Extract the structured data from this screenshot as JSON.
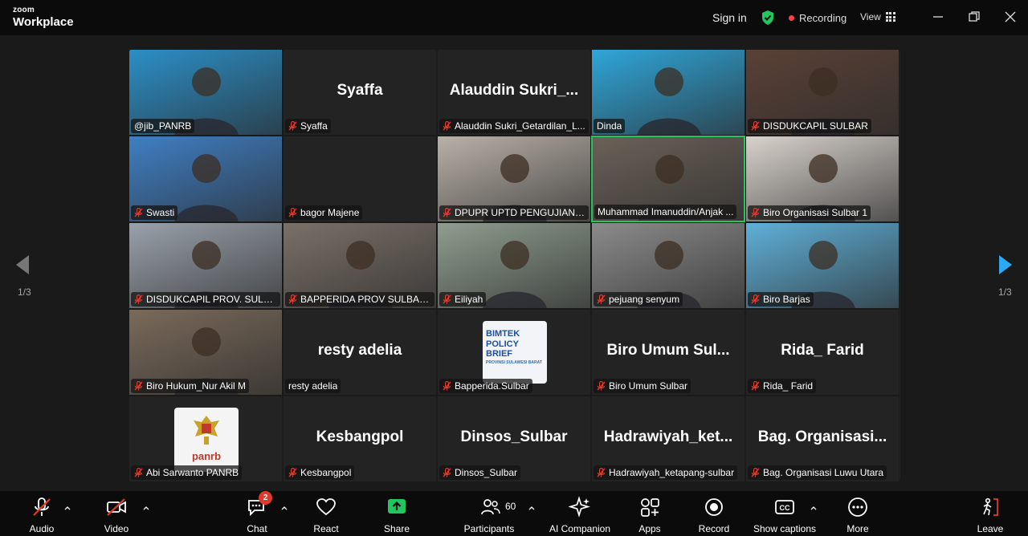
{
  "app": {
    "brand_top": "zoom",
    "brand_bottom": "Workplace"
  },
  "header": {
    "sign_in": "Sign in",
    "recording": "Recording",
    "view": "View"
  },
  "pager": {
    "left": "1/3",
    "right": "1/3"
  },
  "tiles": [
    {
      "name": "",
      "label": "@jib_PANRB",
      "muted": false,
      "type": "photo",
      "bg": "#2b8fc7"
    },
    {
      "name": "Syaffa",
      "label": "Syaffa",
      "muted": true,
      "type": "name"
    },
    {
      "name": "Alauddin  Sukri_...",
      "label": "Alauddin Sukri_Getardilan_L...",
      "muted": true,
      "type": "name"
    },
    {
      "name": "",
      "label": "Dinda",
      "muted": false,
      "type": "photo",
      "bg": "#2fa6d9"
    },
    {
      "name": "",
      "label": "DISDUKCAPIL SULBAR",
      "muted": true,
      "type": "photo",
      "bg": "#5a4136"
    },
    {
      "name": "",
      "label": "Swasti",
      "muted": true,
      "type": "photo",
      "bg": "#3f7fc4"
    },
    {
      "name": "",
      "label": "bagor Majene",
      "muted": true,
      "type": "name"
    },
    {
      "name": "",
      "label": "DPUPR UPTD PENGUJIAN D...",
      "muted": true,
      "type": "photo",
      "bg": "#b9b1a8"
    },
    {
      "name": "",
      "label": "Muhammad Imanuddin/Anjak ...",
      "muted": false,
      "type": "photo",
      "bg": "#6b6158",
      "active": true
    },
    {
      "name": "",
      "label": "Biro Organisasi Sulbar 1",
      "muted": true,
      "type": "photo",
      "bg": "#d8d2cc"
    },
    {
      "name": "",
      "label": "DISDUKCAPIL PROV. SULBAR",
      "muted": true,
      "type": "photo",
      "bg": "#9aa1ab"
    },
    {
      "name": "",
      "label": "BAPPERIDA PROV SULBAR_S...",
      "muted": true,
      "type": "photo",
      "bg": "#7a7068"
    },
    {
      "name": "",
      "label": "Eiliyah",
      "muted": true,
      "type": "photo",
      "bg": "#8f9d8f"
    },
    {
      "name": "",
      "label": "pejuang senyum",
      "muted": true,
      "type": "photo",
      "bg": "#8b8b8b"
    },
    {
      "name": "",
      "label": "Biro Barjas",
      "muted": true,
      "type": "photo",
      "bg": "#5fb0d8"
    },
    {
      "name": "",
      "label": "Biro Hukum_Nur Akil M",
      "muted": true,
      "type": "photo",
      "bg": "#7a6a5a"
    },
    {
      "name": "resty adelia",
      "label": "resty adelia",
      "muted": false,
      "type": "name"
    },
    {
      "name": "",
      "label": "Bapperida.Sulbar",
      "muted": true,
      "type": "logo-bimtek",
      "logo_lines": [
        "BIMTEK",
        "POLICY BRIEF",
        "PROVINSI SULAWESI BARAT"
      ]
    },
    {
      "name": "Biro  Umum  Sul...",
      "label": "Biro Umum Sulbar",
      "muted": true,
      "type": "name"
    },
    {
      "name": "Rida_  Farid",
      "label": "Rida_ Farid",
      "muted": true,
      "type": "name"
    },
    {
      "name": "",
      "label": "Abi Sarwanto PANRB",
      "muted": true,
      "type": "logo-panrb",
      "logo_text": "panrb"
    },
    {
      "name": "Kesbangpol",
      "label": "Kesbangpol",
      "muted": true,
      "type": "name"
    },
    {
      "name": "Dinsos_Sulbar",
      "label": "Dinsos_Sulbar",
      "muted": true,
      "type": "name"
    },
    {
      "name": "Hadrawiyah_ket...",
      "label": "Hadrawiyah_ketapang-sulbar",
      "muted": true,
      "type": "name"
    },
    {
      "name": "Bag.  Organisasi...",
      "label": "Bag. Organisasi Luwu Utara",
      "muted": true,
      "type": "name"
    }
  ],
  "toolbar": {
    "audio": "Audio",
    "video": "Video",
    "chat": "Chat",
    "chat_badge": "2",
    "react": "React",
    "share": "Share",
    "participants": "Participants",
    "participants_count": "60",
    "ai": "AI Companion",
    "apps": "Apps",
    "record": "Record",
    "captions": "Show captions",
    "more": "More",
    "leave": "Leave"
  }
}
